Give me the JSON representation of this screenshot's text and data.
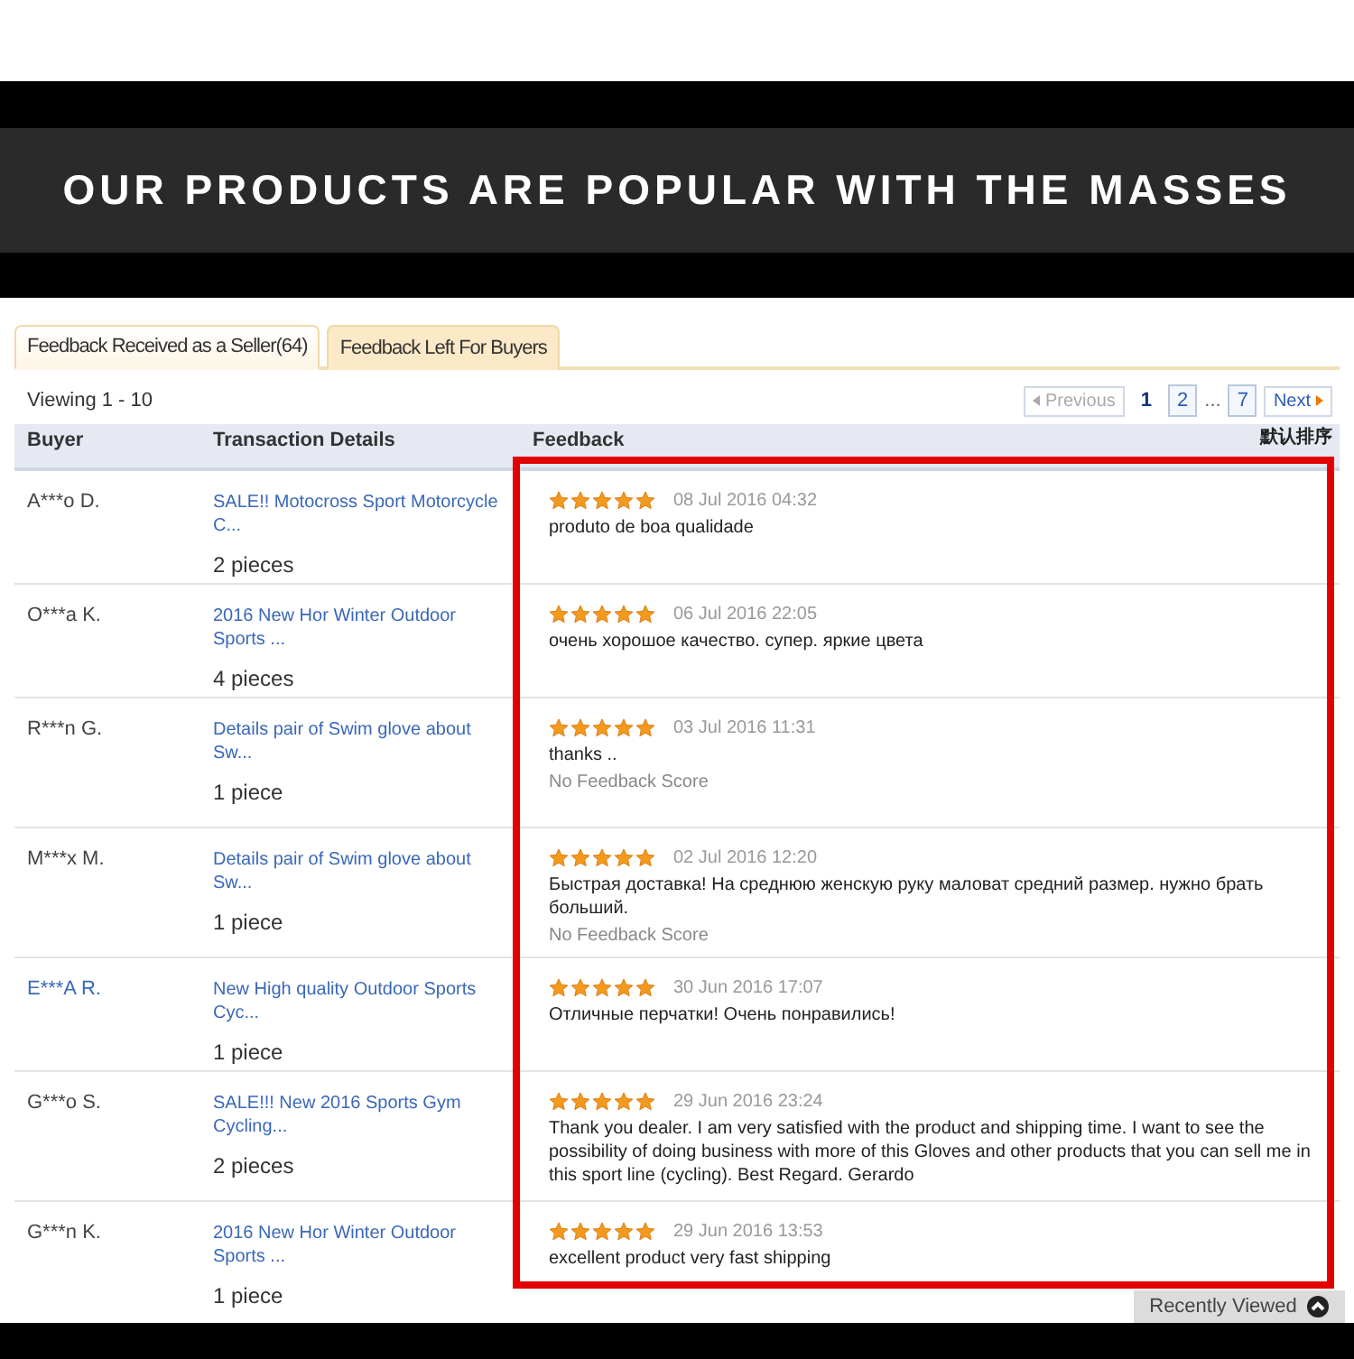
{
  "banner": {
    "title": "OUR PRODUCTS ARE POPULAR WITH THE MASSES"
  },
  "tabs": [
    {
      "label": "Feedback Received as a Seller(64)",
      "selected": true
    },
    {
      "label": "Feedback Left For Buyers",
      "selected": false
    }
  ],
  "viewing": "Viewing 1 - 10",
  "pagination": {
    "previous": {
      "label": "Previous",
      "disabled": true
    },
    "pages": [
      {
        "label": "1",
        "selected": true,
        "kind": "page"
      },
      {
        "label": "2",
        "selected": false,
        "kind": "page"
      },
      {
        "label": "...",
        "kind": "gap"
      },
      {
        "label": "7",
        "selected": false,
        "kind": "page"
      }
    ],
    "next": {
      "label": "Next",
      "disabled": false
    }
  },
  "table": {
    "columns": [
      "Buyer",
      "Transaction Details",
      "Feedback"
    ],
    "sort_label": "默认排序",
    "rows": [
      {
        "buyer": "A***o D.",
        "buyer_link": false,
        "item": "SALE!! Motocross Sport Motorcycle C...",
        "quantity": "2 pieces",
        "stars": 5,
        "date": "08 Jul 2016 04:32",
        "comment": "produto de boa qualidade"
      },
      {
        "buyer": "O***a K.",
        "buyer_link": false,
        "item": "2016 New Hor Winter Outdoor Sports ...",
        "quantity": "4 pieces",
        "stars": 5,
        "date": "06 Jul 2016 22:05",
        "comment": "очень хорошое качество. супер. яркие цвета"
      },
      {
        "buyer": "R***n G.",
        "buyer_link": false,
        "item": "Details pair of Swim glove about Sw...",
        "quantity": "1 piece",
        "stars": 5,
        "date": "03 Jul 2016 11:31",
        "comment": "thanks ..",
        "score_note": "No Feedback Score"
      },
      {
        "buyer": "M***x M.",
        "buyer_link": false,
        "item": "Details pair of Swim glove about Sw...",
        "quantity": "1 piece",
        "stars": 5,
        "date": "02 Jul 2016 12:20",
        "comment": "Быстрая доставка! На среднюю женскую руку маловат средний размер. нужно брать больший.",
        "score_note": "No Feedback Score"
      },
      {
        "buyer": "E***A R.",
        "buyer_link": true,
        "item": "New High quality Outdoor Sports Cyc...",
        "quantity": "1 piece",
        "stars": 5,
        "date": "30 Jun 2016 17:07",
        "comment": "Отличные перчатки! Очень понравились!"
      },
      {
        "buyer": "G***o S.",
        "buyer_link": false,
        "item": "SALE!!! New 2016 Sports Gym Cycling...",
        "quantity": "2 pieces",
        "stars": 5,
        "date": "29 Jun 2016 23:24",
        "comment": "Thank you dealer. I am very satisfied with the product and shipping time. I want to see the possibility of doing business with more of this Gloves and other products that you can sell me in this sport line (cycling). Best Regard. Gerardo"
      },
      {
        "buyer": "G***n K.",
        "buyer_link": false,
        "item": "2016 New Hor Winter Outdoor Sports ...",
        "quantity": "1 piece",
        "stars": 5,
        "date": "29 Jun 2016 13:53",
        "comment": "excellent product very fast shipping"
      }
    ]
  },
  "recently_viewed": {
    "label": "Recently Viewed"
  }
}
